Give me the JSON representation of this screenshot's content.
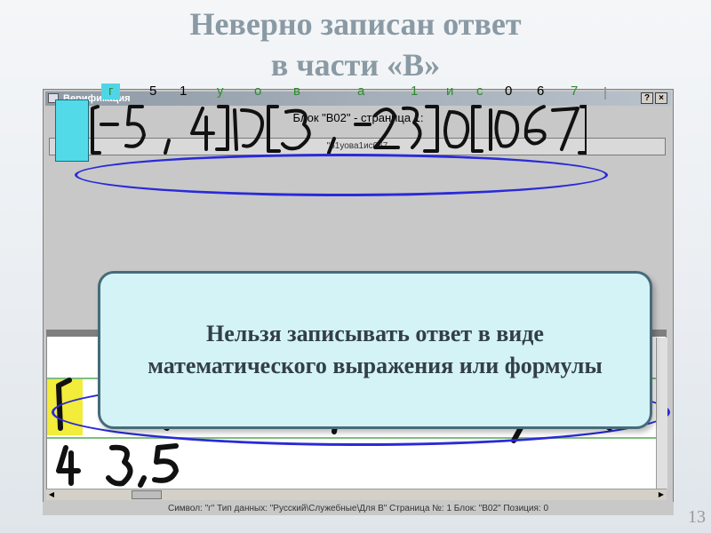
{
  "slide": {
    "title_line1": "Неверно записан ответ",
    "title_line2": "в части «В»",
    "page_number": "13"
  },
  "window": {
    "title": "Верификация",
    "help_button": "?",
    "close_button": "×",
    "block_header": "Блок \"B02\" - страница 1:",
    "answer_value": "\"51уова1ис067"
  },
  "recognized_chars": [
    {
      "ch": "г",
      "highlight": true,
      "color": "g"
    },
    {
      "ch": "5",
      "highlight": false,
      "color": "k"
    },
    {
      "ch": "1",
      "highlight": false,
      "color": "k"
    },
    {
      "ch": "у",
      "highlight": false,
      "color": "g"
    },
    {
      "ch": "о",
      "highlight": false,
      "color": "g"
    },
    {
      "ch": "в",
      "highlight": false,
      "color": "g"
    },
    {
      "ch": "а",
      "highlight": false,
      "color": "g"
    },
    {
      "ch": "1",
      "highlight": false,
      "color": "g"
    },
    {
      "ch": "и",
      "highlight": false,
      "color": "g"
    },
    {
      "ch": "с",
      "highlight": false,
      "color": "g"
    },
    {
      "ch": "0",
      "highlight": false,
      "color": "k"
    },
    {
      "ch": "6",
      "highlight": false,
      "color": "k"
    },
    {
      "ch": "7",
      "highlight": false,
      "color": "g"
    }
  ],
  "callout_text": "Нельзя записывать ответ в виде математического выражения или формулы",
  "statusbar": "Символ: \"г\"   Тип данных: \"Русский\\Служебные\\Для В\"   Страница №: 1   Блок: \"B02\"   Позиция: 0",
  "colors": {
    "highlight_cyan": "#52dae8",
    "highlight_yellow": "#f2ec3a",
    "ellipse_blue": "#2a2ad8",
    "callout_fill": "#d3f3f7"
  }
}
